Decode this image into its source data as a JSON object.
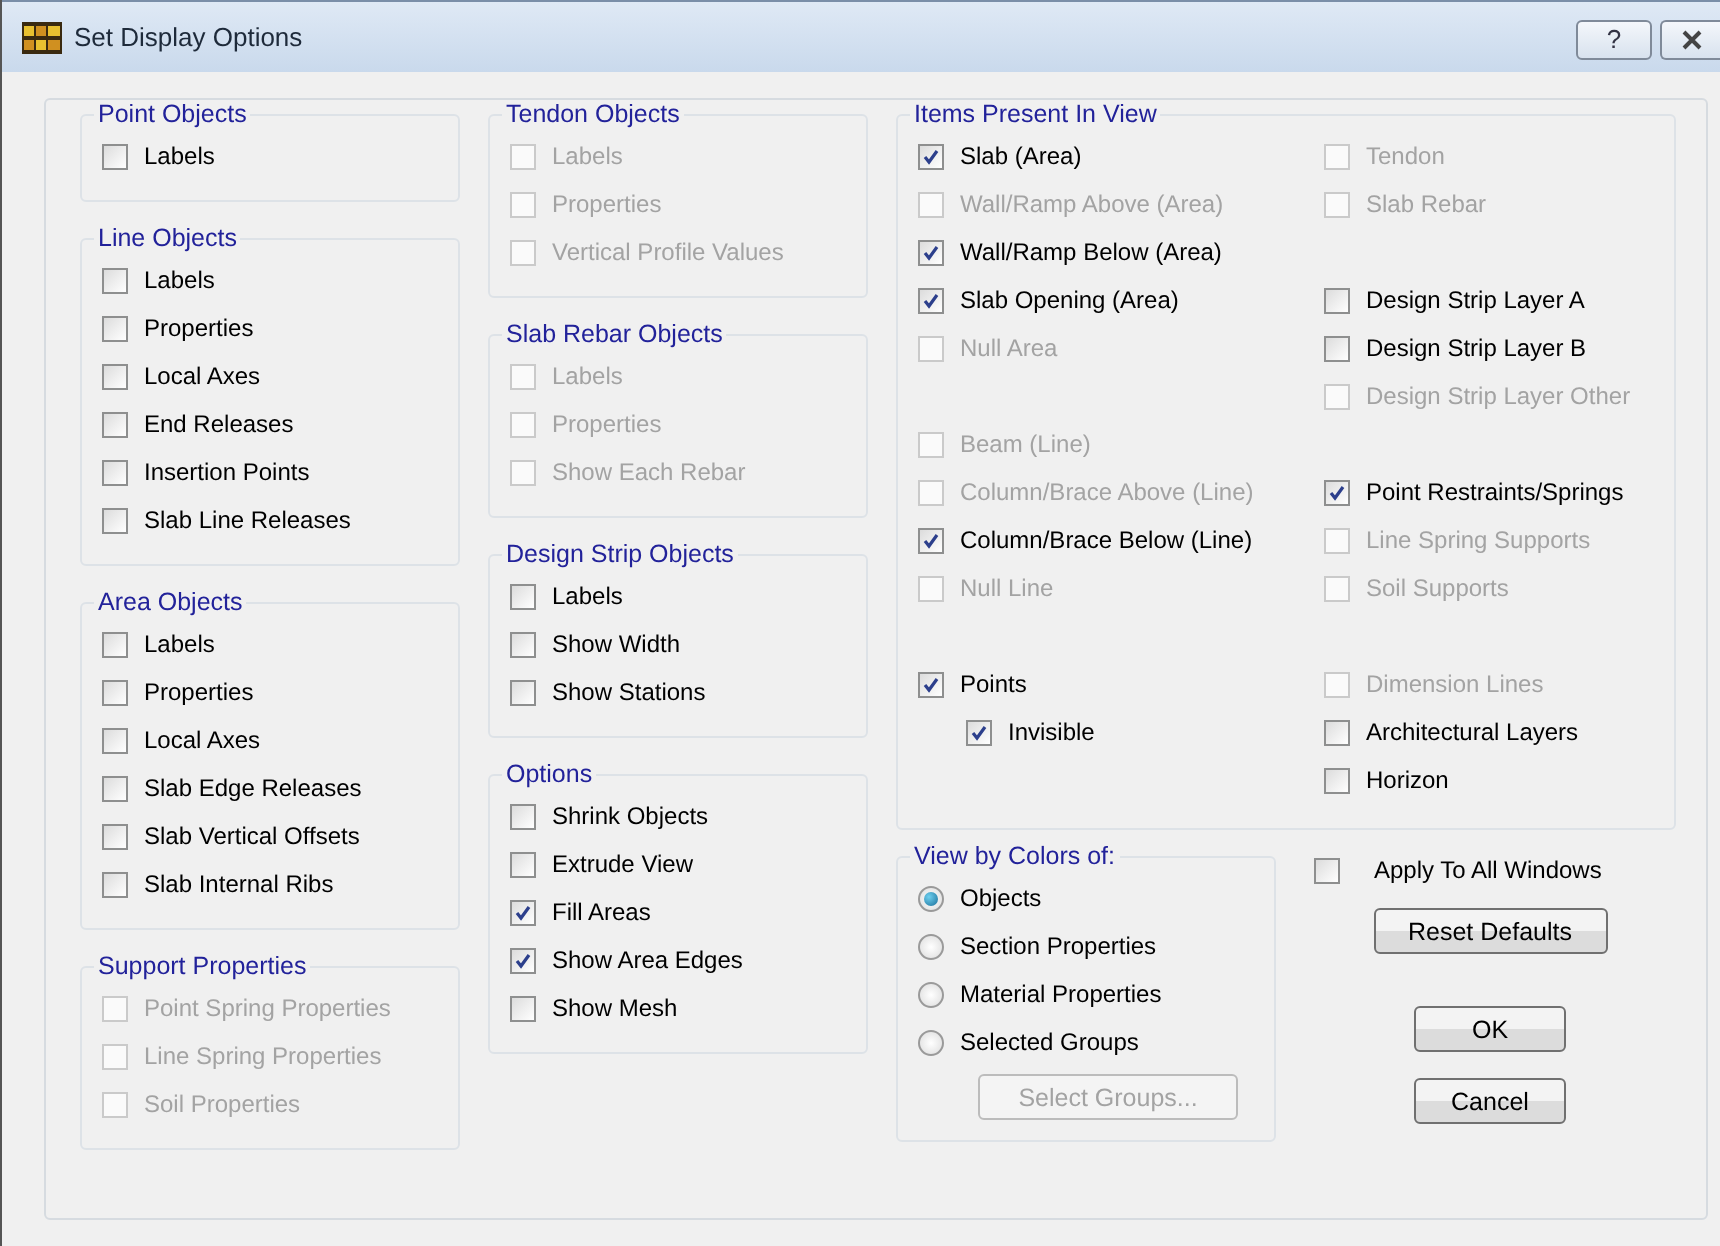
{
  "window": {
    "title": "Set Display Options",
    "help_button": {
      "label": "?"
    }
  },
  "columns": [
    [
      {
        "title": "Point Objects",
        "items": [
          {
            "label": "Labels",
            "checked": false,
            "disabled": false
          }
        ]
      },
      {
        "title": "Line Objects",
        "items": [
          {
            "label": "Labels",
            "checked": false,
            "disabled": false
          },
          {
            "label": "Properties",
            "checked": false,
            "disabled": false
          },
          {
            "label": "Local Axes",
            "checked": false,
            "disabled": false
          },
          {
            "label": "End Releases",
            "checked": false,
            "disabled": false
          },
          {
            "label": "Insertion Points",
            "checked": false,
            "disabled": false
          },
          {
            "label": "Slab Line Releases",
            "checked": false,
            "disabled": false
          }
        ]
      },
      {
        "title": "Area Objects",
        "items": [
          {
            "label": "Labels",
            "checked": false,
            "disabled": false
          },
          {
            "label": "Properties",
            "checked": false,
            "disabled": false
          },
          {
            "label": "Local Axes",
            "checked": false,
            "disabled": false
          },
          {
            "label": "Slab Edge Releases",
            "checked": false,
            "disabled": false
          },
          {
            "label": "Slab Vertical Offsets",
            "checked": false,
            "disabled": false
          },
          {
            "label": "Slab Internal Ribs",
            "checked": false,
            "disabled": false
          }
        ]
      },
      {
        "title": "Support Properties",
        "items": [
          {
            "label": "Point Spring Properties",
            "checked": false,
            "disabled": true
          },
          {
            "label": "Line Spring Properties",
            "checked": false,
            "disabled": true
          },
          {
            "label": "Soil Properties",
            "checked": false,
            "disabled": true
          }
        ]
      }
    ],
    [
      {
        "title": "Tendon Objects",
        "items": [
          {
            "label": "Labels",
            "checked": false,
            "disabled": true
          },
          {
            "label": "Properties",
            "checked": false,
            "disabled": true
          },
          {
            "label": "Vertical Profile Values",
            "checked": false,
            "disabled": true
          }
        ]
      },
      {
        "title": "Slab Rebar Objects",
        "items": [
          {
            "label": "Labels",
            "checked": false,
            "disabled": true
          },
          {
            "label": "Properties",
            "checked": false,
            "disabled": true
          },
          {
            "label": "Show Each Rebar",
            "checked": false,
            "disabled": true
          }
        ]
      },
      {
        "title": "Design Strip Objects",
        "items": [
          {
            "label": "Labels",
            "checked": false,
            "disabled": false
          },
          {
            "label": "Show Width",
            "checked": false,
            "disabled": false
          },
          {
            "label": "Show Stations",
            "checked": false,
            "disabled": false
          }
        ]
      },
      {
        "title": "Options",
        "items": [
          {
            "label": "Shrink Objects",
            "checked": false,
            "disabled": false
          },
          {
            "label": "Extrude View",
            "checked": false,
            "disabled": false
          },
          {
            "label": "Fill Areas",
            "checked": true,
            "disabled": false
          },
          {
            "label": "Show Area Edges",
            "checked": true,
            "disabled": false
          },
          {
            "label": "Show Mesh",
            "checked": false,
            "disabled": false
          }
        ]
      }
    ]
  ],
  "items_present_in_view": {
    "title": "Items Present In View",
    "columns": [
      [
        {
          "items": [
            {
              "label": "Slab (Area)",
              "checked": true,
              "disabled": false
            },
            {
              "label": "Wall/Ramp Above (Area)",
              "checked": false,
              "disabled": true
            },
            {
              "label": "Wall/Ramp Below (Area)",
              "checked": true,
              "disabled": false
            },
            {
              "label": "Slab Opening (Area)",
              "checked": true,
              "disabled": false
            },
            {
              "label": "Null Area",
              "checked": false,
              "disabled": true
            }
          ]
        },
        {
          "items": [
            {
              "label": "Beam (Line)",
              "checked": false,
              "disabled": true
            },
            {
              "label": "Column/Brace Above (Line)",
              "checked": false,
              "disabled": true
            },
            {
              "label": "Column/Brace Below (Line)",
              "checked": true,
              "disabled": false
            },
            {
              "label": "Null Line",
              "checked": false,
              "disabled": true
            }
          ]
        },
        {
          "items": [
            {
              "label": "Points",
              "checked": true,
              "disabled": false,
              "children": [
                {
                  "label": "Invisible",
                  "checked": true,
                  "disabled": false
                }
              ]
            }
          ]
        }
      ],
      [
        {
          "items": [
            {
              "label": "Tendon",
              "checked": false,
              "disabled": true
            },
            {
              "label": "Slab Rebar",
              "checked": false,
              "disabled": true
            }
          ]
        },
        {
          "items": [
            {
              "label": "Design Strip Layer A",
              "checked": false,
              "disabled": false
            },
            {
              "label": "Design Strip Layer B",
              "checked": false,
              "disabled": false
            },
            {
              "label": "Design Strip Layer Other",
              "checked": false,
              "disabled": true
            }
          ]
        },
        {
          "items": [
            {
              "label": "Point Restraints/Springs",
              "checked": true,
              "disabled": false
            },
            {
              "label": "Line Spring Supports",
              "checked": false,
              "disabled": true
            },
            {
              "label": "Soil Supports",
              "checked": false,
              "disabled": true
            }
          ]
        },
        {
          "items": [
            {
              "label": "Dimension Lines",
              "checked": false,
              "disabled": true
            },
            {
              "label": "Architectural Layers",
              "checked": false,
              "disabled": false
            },
            {
              "label": "Horizon",
              "checked": false,
              "disabled": false
            }
          ]
        }
      ]
    ]
  },
  "view_by_colors": {
    "title": "View by Colors of:",
    "options": [
      {
        "label": "Objects",
        "selected": true
      },
      {
        "label": "Section Properties",
        "selected": false
      },
      {
        "label": "Material Properties",
        "selected": false
      },
      {
        "label": "Selected Groups",
        "selected": false
      }
    ],
    "button": {
      "label": "Select Groups...",
      "disabled": true
    }
  },
  "apply_to_all_windows": {
    "label": "Apply To All Windows",
    "checked": false
  },
  "buttons": [
    {
      "label": "Reset Defaults"
    },
    {
      "label": "OK"
    },
    {
      "label": "Cancel"
    }
  ]
}
